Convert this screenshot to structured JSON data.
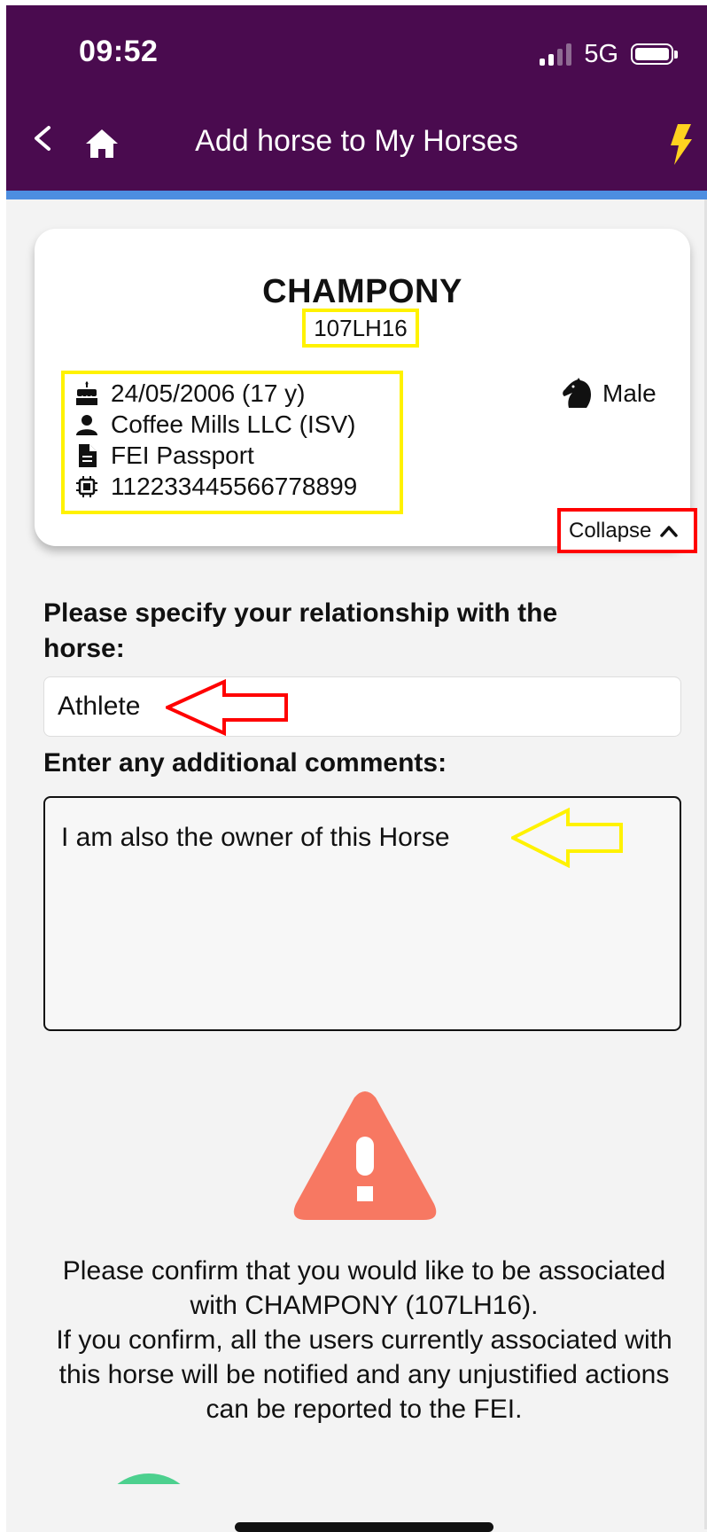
{
  "status_bar": {
    "time": "09:52",
    "network": "5G"
  },
  "nav": {
    "title": "Add horse to My Horses"
  },
  "horse": {
    "name": "CHAMPONY",
    "id": "107LH16",
    "birth": "24/05/2006 (17 y)",
    "owner": "Coffee Mills LLC (ISV)",
    "passport": "FEI Passport",
    "chip": "112233445566778899",
    "gender": "Male",
    "collapse_label": "Collapse"
  },
  "form": {
    "relationship_label": "Please specify your relationship with the horse:",
    "relationship_value": "Athlete",
    "comments_label": "Enter any additional comments:",
    "comments_value": "I am also the owner of this Horse"
  },
  "confirmation": {
    "line1": "Please confirm that you would like to be associated with CHAMPONY (107LH16).",
    "line2": "If you confirm, all the users currently associated with this horse will be notified and any unjustified actions can be reported to the FEI."
  },
  "colors": {
    "header_bg": "#4a0b4f",
    "accent_bar": "#4d8ee0",
    "highlight_yellow": "#fff200",
    "highlight_red": "#ff0000",
    "warning": "#f77862",
    "confirm_button": "#4cd08e",
    "bolt": "#ffd21f"
  },
  "icons": [
    "back-chevron-icon",
    "home-icon",
    "lightning-bolt-icon",
    "birthday-cake-icon",
    "person-icon",
    "document-icon",
    "microchip-icon",
    "horse-head-icon",
    "chevron-up-icon",
    "warning-triangle-icon"
  ]
}
